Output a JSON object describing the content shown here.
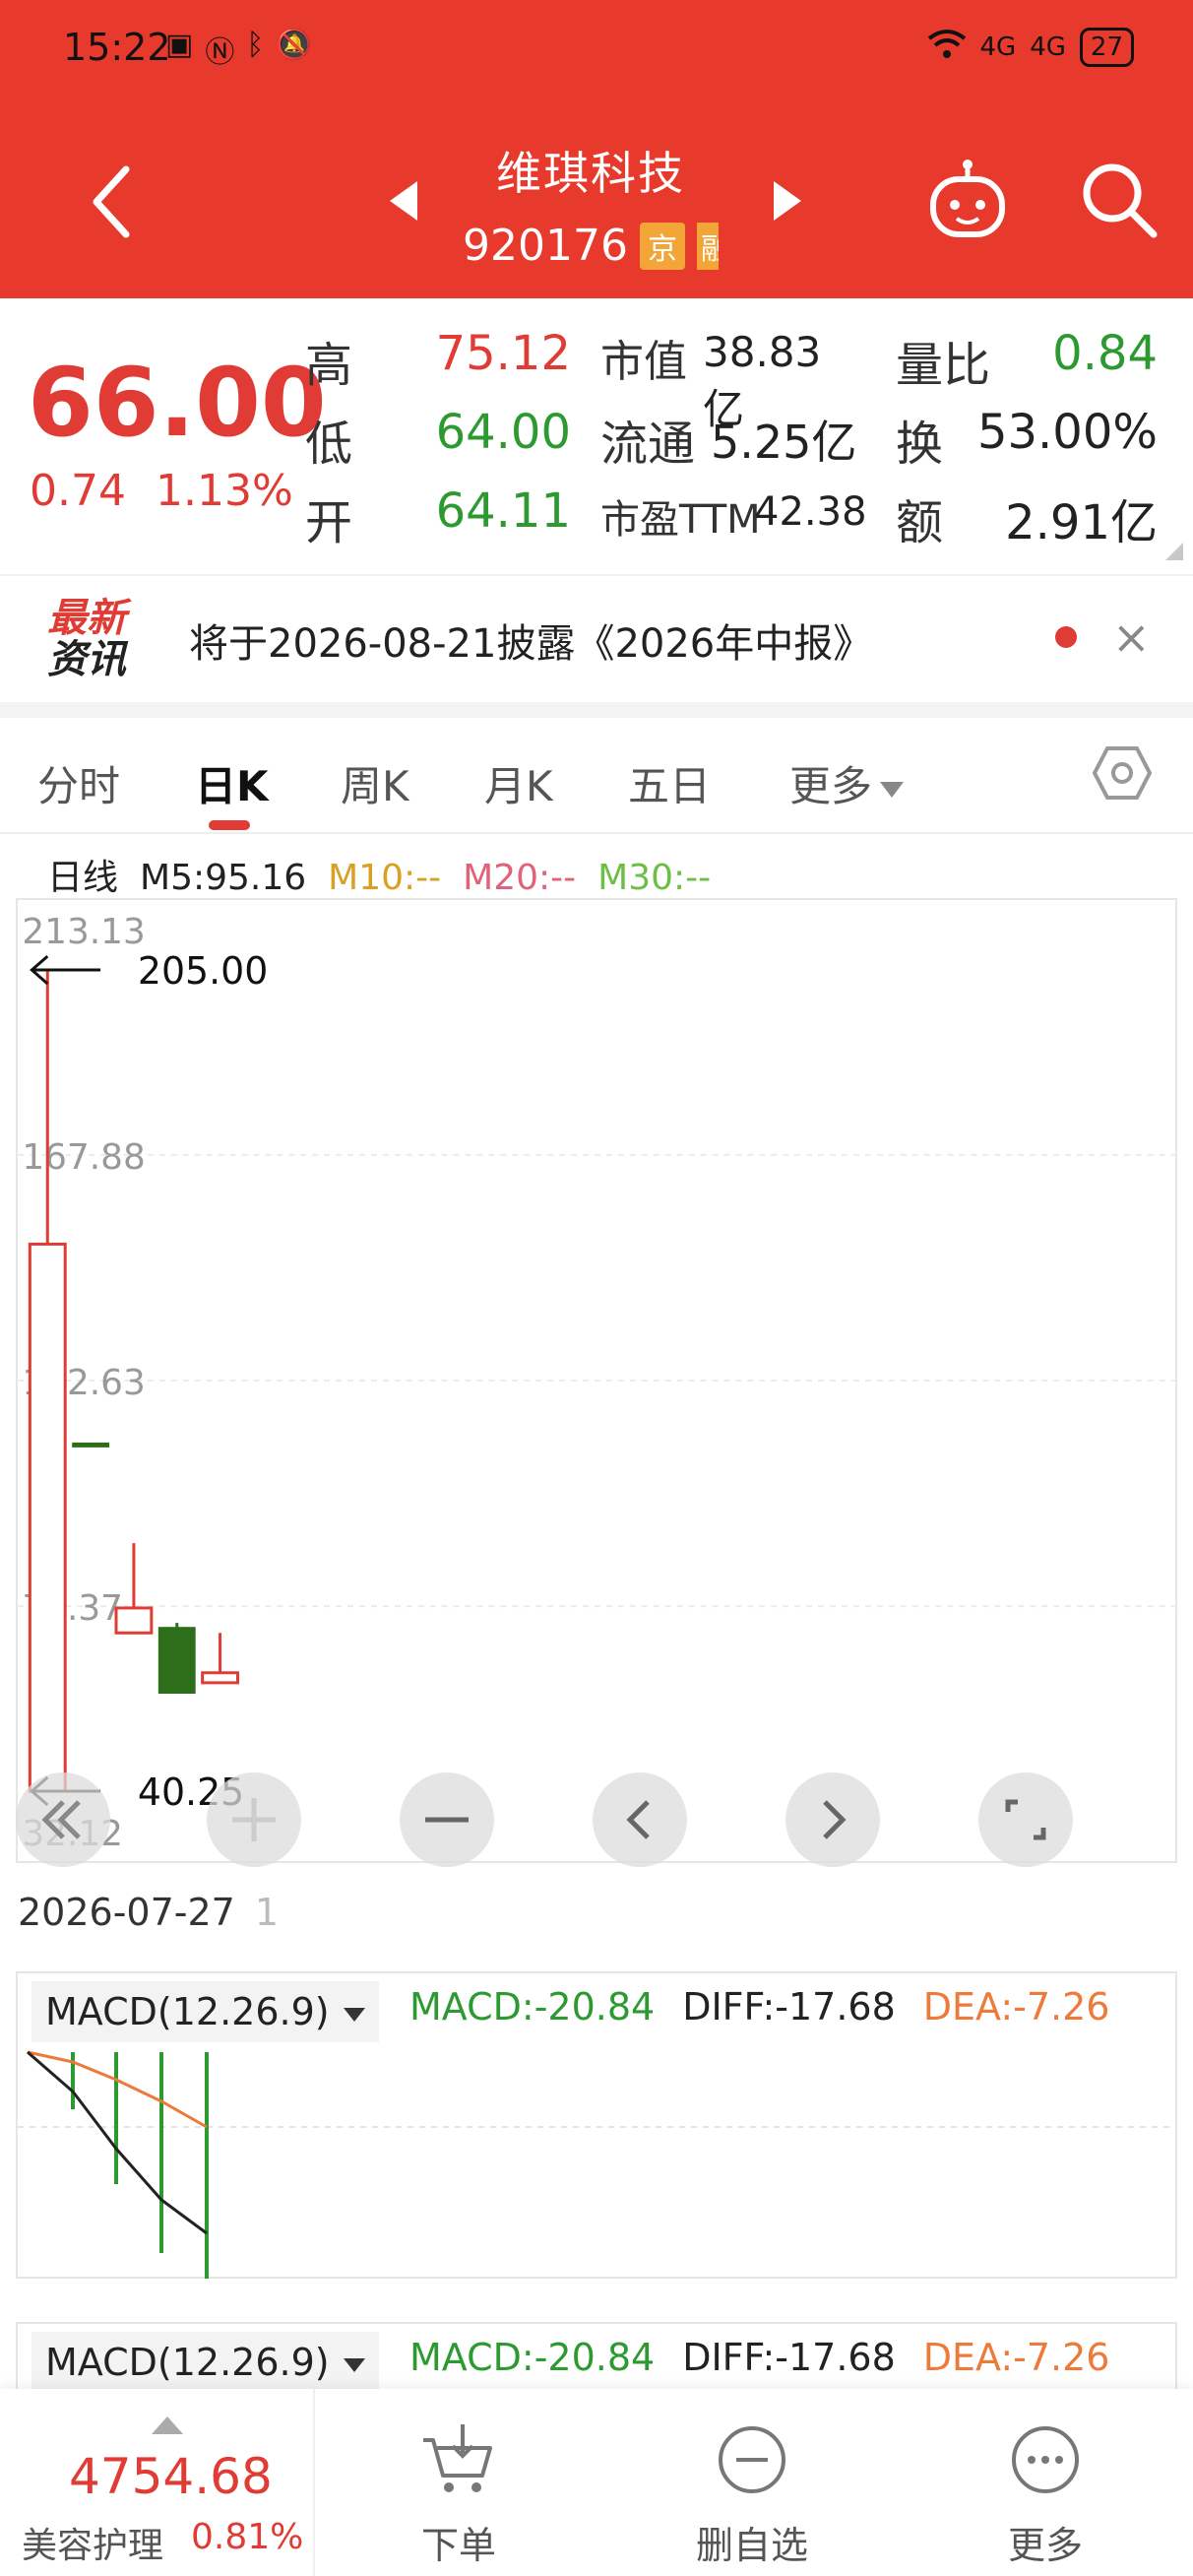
{
  "status": {
    "time": "15:22",
    "signal1": "4G",
    "signal2": "4G",
    "battery": "27"
  },
  "header": {
    "stock_name": "维琪科技",
    "stock_code": "920176",
    "tag_exchange": "京",
    "tag_margin": "融"
  },
  "quote": {
    "price": "66.00",
    "change": "0.74",
    "change_pct": "1.13%",
    "rows": [
      {
        "l1": "高",
        "v1": "75.12",
        "l2": "市值",
        "v2": "38.83亿",
        "l3": "量比",
        "v3": "0.84"
      },
      {
        "l1": "低",
        "v1": "64.00",
        "l2": "流通",
        "v2": "5.25亿",
        "l3": "换",
        "v3": "53.00%"
      },
      {
        "l1": "开",
        "v1": "64.11",
        "l2": "市盈TTM",
        "v2": "42.38",
        "l3": "额",
        "v3": "2.91亿"
      }
    ]
  },
  "news": {
    "logo_line1": "最新",
    "logo_line2": "资讯",
    "text": "将于2026-08-21披露《2026年中报》",
    "close": "×"
  },
  "tabs": [
    {
      "label": "分时"
    },
    {
      "label": "日K"
    },
    {
      "label": "周K"
    },
    {
      "label": "月K"
    },
    {
      "label": "五日"
    },
    {
      "label": "更多"
    }
  ],
  "ma": {
    "label": "日线",
    "m5": "M5:95.16",
    "m10": "M10:--",
    "m20": "M20:--",
    "m30": "M30:--"
  },
  "colors": {
    "header_red": "#e73a2c",
    "up_red": "#e03b34",
    "down_green": "#2c6e1a"
  },
  "chart_data": {
    "type": "candlestick",
    "y_ticks": [
      "213.13",
      "167.88",
      "122.63",
      "77.37",
      "32.12"
    ],
    "high_marker": "205.00",
    "low_marker": "40.25",
    "candles": [
      {
        "open": 40.25,
        "close": 150.0,
        "high": 205.0,
        "low": 40.25,
        "dir": "up"
      },
      {
        "open": 110.0,
        "close": 110.0,
        "high": 110.0,
        "low": 110.0,
        "dir": "down"
      },
      {
        "open": 72.0,
        "close": 77.0,
        "high": 90.0,
        "low": 72.0,
        "dir": "up"
      },
      {
        "open": 73.0,
        "close": 60.0,
        "high": 74.0,
        "low": 60.0,
        "dir": "down"
      },
      {
        "open": 62.0,
        "close": 64.0,
        "high": 72.0,
        "low": 62.0,
        "dir": "up"
      }
    ],
    "date": "2026-07-27",
    "date_next": "1"
  },
  "macd": {
    "label": "MACD(12.26.9)",
    "macd": "MACD:-20.84",
    "diff": "DIFF:-17.68",
    "dea": "DEA:-7.26"
  },
  "bottom": {
    "index_value": "4754.68",
    "index_name": "美容护理",
    "index_pct": "0.81%",
    "order": "下单",
    "remove": "删自选",
    "more": "更多"
  }
}
